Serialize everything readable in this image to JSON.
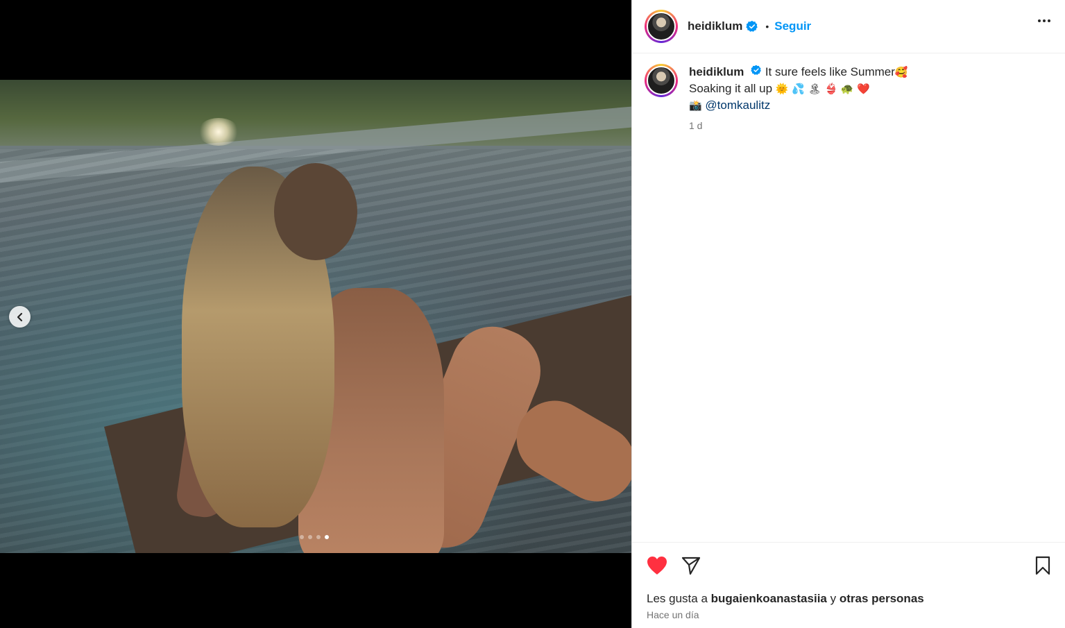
{
  "post": {
    "username": "heidiklum",
    "follow_label": "Seguir",
    "separator": "•",
    "carousel": {
      "slide_count": 4,
      "active_index": 3
    },
    "caption": {
      "line1_text": "It sure feels like Summer",
      "line1_emoji": "🥰",
      "line2_text": "Soaking it all up",
      "line2_emojis": "🌞 💦 🏝 👙 🐢 ❤️",
      "line3_emoji": "📸",
      "mention": "@tomkaulitz",
      "time": "1 d"
    },
    "likes": {
      "prefix": "Les gusta a",
      "user": "bugaienkoanastasiia",
      "connector": "y",
      "others": "otras personas"
    },
    "posted": "Hace un día"
  },
  "colors": {
    "accent": "#0095f6",
    "like": "#ff3040",
    "verified": "#0095f6"
  }
}
